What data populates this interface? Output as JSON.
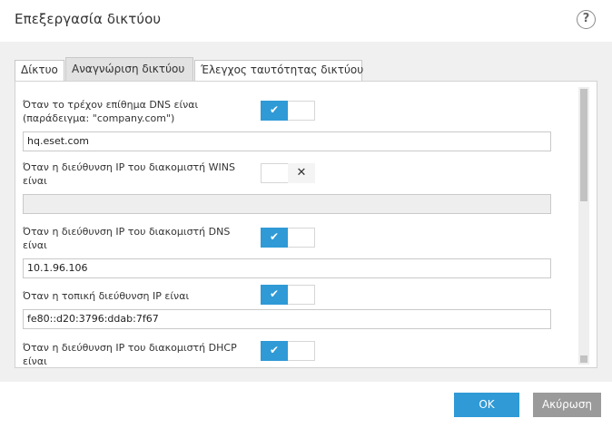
{
  "window": {
    "title": "Επεξεργασία δικτύου",
    "help_glyph": "?"
  },
  "tabs": [
    {
      "label": "Δίκτυο",
      "active": false
    },
    {
      "label": "Αναγνώριση δικτύου",
      "active": true
    },
    {
      "label": "Έλεγχος ταυτότητας δικτύου",
      "active": false
    }
  ],
  "conditions": [
    {
      "label": "Όταν το τρέχον επίθημα DNS είναι (παράδειγμα: \"company.com\")",
      "toggle": "on",
      "value": "hq.eset.com"
    },
    {
      "label": "Όταν η διεύθυνση IP του διακομιστή WINS είναι",
      "toggle": "off",
      "value": ""
    },
    {
      "label": "Όταν η διεύθυνση IP του διακομιστή DNS είναι",
      "toggle": "on",
      "value": "10.1.96.106"
    },
    {
      "label": "Όταν η τοπική διεύθυνση IP είναι",
      "toggle": "on",
      "value": "fe80::d20:3796:ddab:7f67"
    },
    {
      "label": "Όταν η διεύθυνση IP του διακομιστή DHCP είναι",
      "toggle": "on",
      "value": ""
    }
  ],
  "toggle_glyphs": {
    "on": "✔",
    "off": "✕"
  },
  "buttons": {
    "ok": "OK",
    "cancel": "Ακύρωση"
  },
  "colors": {
    "accent": "#2f9ad6",
    "cancel": "#9a9a9a",
    "content_bg": "#f0f0f0"
  }
}
